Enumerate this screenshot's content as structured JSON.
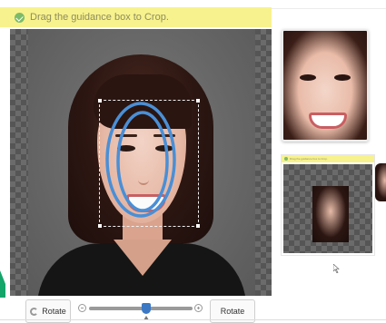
{
  "notice": {
    "text": "Drag the guidance box to Crop.",
    "icon": "check-circle-icon",
    "bg_color": "#f7f28d"
  },
  "controls": {
    "rotate_left_label": "Rotate",
    "rotate_right_label": "Rotate",
    "zoom": {
      "value_fraction": 0.55
    }
  },
  "preview_card": {
    "header_text": "Drag the guidance box to Crop."
  },
  "colors": {
    "accent": "#3c78c4",
    "guide": "#4a8fd6"
  }
}
